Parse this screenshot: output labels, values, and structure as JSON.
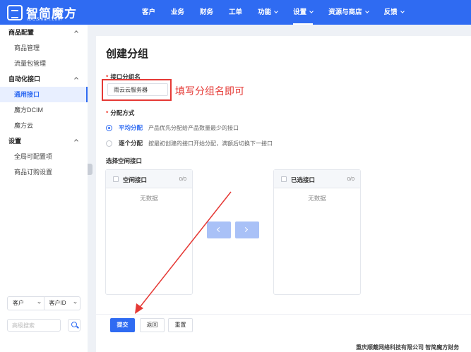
{
  "brand": {
    "title": "智简魔方",
    "subtitle": "IDCSmart.com"
  },
  "nav": [
    {
      "label": "客户",
      "dropdown": false,
      "active": false
    },
    {
      "label": "业务",
      "dropdown": false,
      "active": false
    },
    {
      "label": "财务",
      "dropdown": false,
      "active": false
    },
    {
      "label": "工单",
      "dropdown": false,
      "active": false
    },
    {
      "label": "功能",
      "dropdown": true,
      "active": false
    },
    {
      "label": "设置",
      "dropdown": true,
      "active": true
    },
    {
      "label": "资源与商店",
      "dropdown": true,
      "active": false
    },
    {
      "label": "反馈",
      "dropdown": true,
      "active": false
    }
  ],
  "sidebar": {
    "groups": [
      {
        "label": "商品配置",
        "items": [
          {
            "label": "商品管理",
            "active": false
          },
          {
            "label": "流量包管理",
            "active": false
          }
        ]
      },
      {
        "label": "自动化接口",
        "items": [
          {
            "label": "通用接口",
            "active": true
          },
          {
            "label": "魔方DCIM",
            "active": false
          },
          {
            "label": "魔方云",
            "active": false
          }
        ]
      },
      {
        "label": "设置",
        "items": [
          {
            "label": "全局可配置项",
            "active": false
          },
          {
            "label": "商品订购设置",
            "active": false
          }
        ]
      }
    ],
    "select_client": "客户",
    "select_client_id": "客户ID",
    "search_placeholder": "高级搜索"
  },
  "form": {
    "title": "创建分组",
    "name_label": "接口分组名",
    "name_value": "雨云云服务器",
    "annotation": "填写分组名即可",
    "method_label": "分配方式",
    "methods": [
      {
        "label": "平均分配",
        "desc": "产品优先分配给产品数量最少的接口",
        "checked": true
      },
      {
        "label": "逐个分配",
        "desc": "按最初创建的接口开始分配，满额后切换下一接口",
        "checked": false
      }
    ],
    "select_label": "选择空闲接口",
    "left_panel": {
      "title": "空闲接口",
      "count": "0/0",
      "empty": "无数据"
    },
    "right_panel": {
      "title": "已选接口",
      "count": "0/0",
      "empty": "无数据"
    },
    "submit": "提交",
    "back": "返回",
    "reset": "重置"
  },
  "footer": {
    "copyright": "重庆顺戴网络科技有限公司 智简魔方财务"
  },
  "colors": {
    "primary": "#2f6bf2",
    "annotation": "#e53935"
  }
}
